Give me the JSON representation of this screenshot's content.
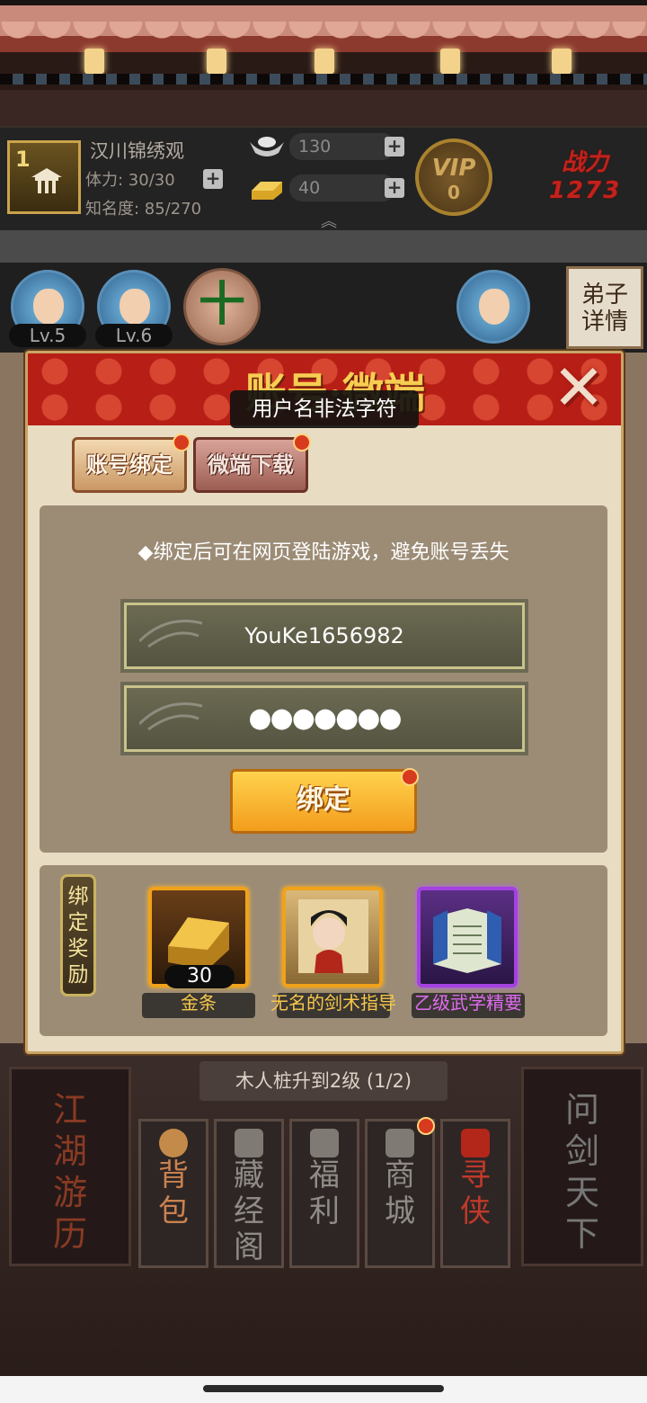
{
  "header": {
    "city_level": "1",
    "city_name": "汉川锦绣观",
    "stamina": "体力: 30/30",
    "fame": "知名度: 85/270",
    "silver": "130",
    "gold": "40",
    "vip_label": "VIP",
    "vip_level": "0",
    "power_label": "战力",
    "power_value": "1273",
    "plus": "+",
    "expand_caret": "︽"
  },
  "disciples": [
    {
      "level": "Lv.5"
    },
    {
      "level": "Lv.6"
    }
  ],
  "add_disciple": "十",
  "detail_tab": "弟子\n详情",
  "dialog": {
    "title": "账号·微端",
    "close": "✕",
    "toast": "用户名非法字符",
    "tabs": [
      {
        "label": "账号绑定",
        "active": true
      },
      {
        "label": "微端下载",
        "active": false
      }
    ],
    "hint": "◆绑定后可在网页登陆游戏，避免账号丢失",
    "username": "YouKe1656982",
    "password": "●●●●●●●",
    "bind_button": "绑定",
    "reward_ribbon": "绑\n定\n奖\n励",
    "rewards": [
      {
        "name": "金条",
        "count": "30",
        "color": "#f7c84b"
      },
      {
        "name": "无名的剑术指导",
        "count": "",
        "color": "#f7c84b"
      },
      {
        "name": "乙级武学精要",
        "count": "",
        "color": "#e06cf0"
      }
    ]
  },
  "bottom": {
    "task": "木人桩升到2级  (1/2)",
    "left_card": "江\n湖\n游\n历",
    "right_card": "问\n剑\n天\n下",
    "menu": [
      {
        "label": "背\n包"
      },
      {
        "label": "藏\n经\n阁"
      },
      {
        "label": "福\n利"
      },
      {
        "label": "商\n城"
      },
      {
        "label": "寻\n侠"
      }
    ]
  }
}
